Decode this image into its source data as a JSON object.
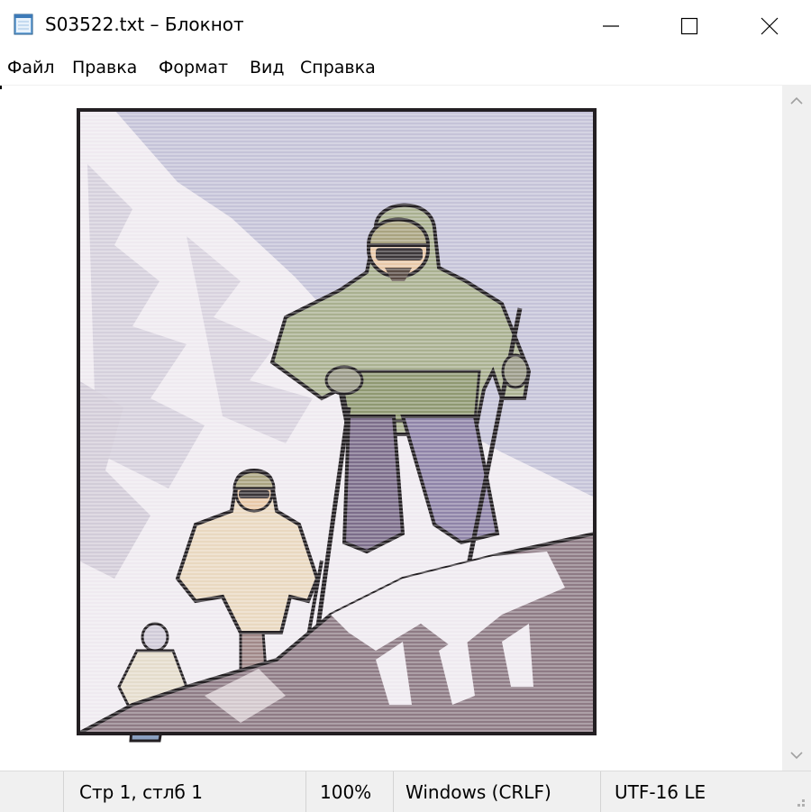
{
  "window": {
    "title": "S03522.txt – Блокнот"
  },
  "menu": {
    "items": [
      "Файл",
      "Правка",
      "Формат",
      "Вид",
      "Справка"
    ]
  },
  "editor": {
    "content_kind": "ascii-art-image",
    "scene": "mountaineers-climbing-snowy-ridge"
  },
  "statusbar": {
    "position": "Стр 1, стлб 1",
    "zoom": "100%",
    "line_endings": "Windows (CRLF)",
    "encoding": "UTF-16 LE"
  },
  "colors": {
    "sky": "#c5c3d8",
    "snow": "#efeaf0",
    "rock": "#8e7b85",
    "jacket_main": "#a9b090",
    "jacket_mid": "#e9d8c0",
    "pants": "#7c6d8a",
    "skin": "#e8c8a8",
    "outline": "#231f22"
  }
}
